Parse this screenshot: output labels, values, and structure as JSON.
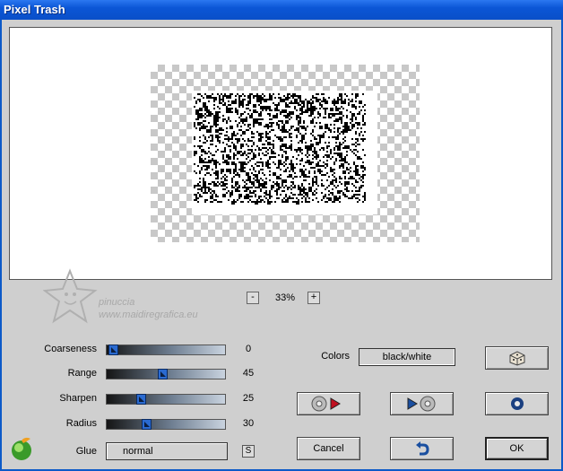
{
  "window": {
    "title": "Pixel Trash"
  },
  "zoom": {
    "value": "33%",
    "minus_label": "-",
    "plus_label": "+"
  },
  "watermark": {
    "line1": "pinuccia",
    "line2": "www.maidiregrafica.eu"
  },
  "sliders": [
    {
      "label": "Coarseness",
      "value": "0",
      "level": 0.0
    },
    {
      "label": "Range",
      "value": "45",
      "level": 0.45
    },
    {
      "label": "Sharpen",
      "value": "25",
      "level": 0.25
    },
    {
      "label": "Radius",
      "value": "30",
      "level": 0.3
    }
  ],
  "glue": {
    "label": "Glue",
    "value": "normal",
    "s_button": "S"
  },
  "colors": {
    "label": "Colors",
    "value": "black/white"
  },
  "buttons": {
    "cancel": "Cancel",
    "ok": "OK"
  },
  "icons": {
    "randomize": "dice-icon",
    "load": "disc-arrow-icon",
    "save": "arrow-disc-icon",
    "reset": "ring-icon",
    "undo": "undo-arrow-icon",
    "logo": "filter-logo-icon"
  },
  "colors_theme": {
    "title_bar": "#0a4fc8",
    "client_bg": "#cfcfcf",
    "accent_red": "#c01020",
    "accent_blue": "#1a4fa0"
  }
}
